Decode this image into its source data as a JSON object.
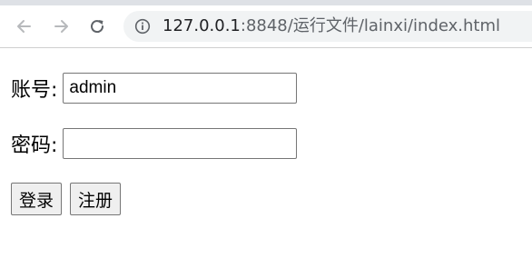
{
  "browser": {
    "url_host": "127.0.0.1",
    "url_path": ":8848/运行文件/lainxi/index.html",
    "back_icon": "arrow-left-icon",
    "forward_icon": "arrow-right-icon",
    "reload_icon": "reload-icon",
    "info_icon": "info-icon"
  },
  "form": {
    "account_label": "账号:",
    "account_value": "admin",
    "password_label": "密码:",
    "password_value": "",
    "login_button": "登录",
    "register_button": "注册"
  },
  "colors": {
    "toolbar_bg": "#ffffff",
    "omnibox_bg": "#f1f3f4",
    "button_bg": "#efefef"
  }
}
